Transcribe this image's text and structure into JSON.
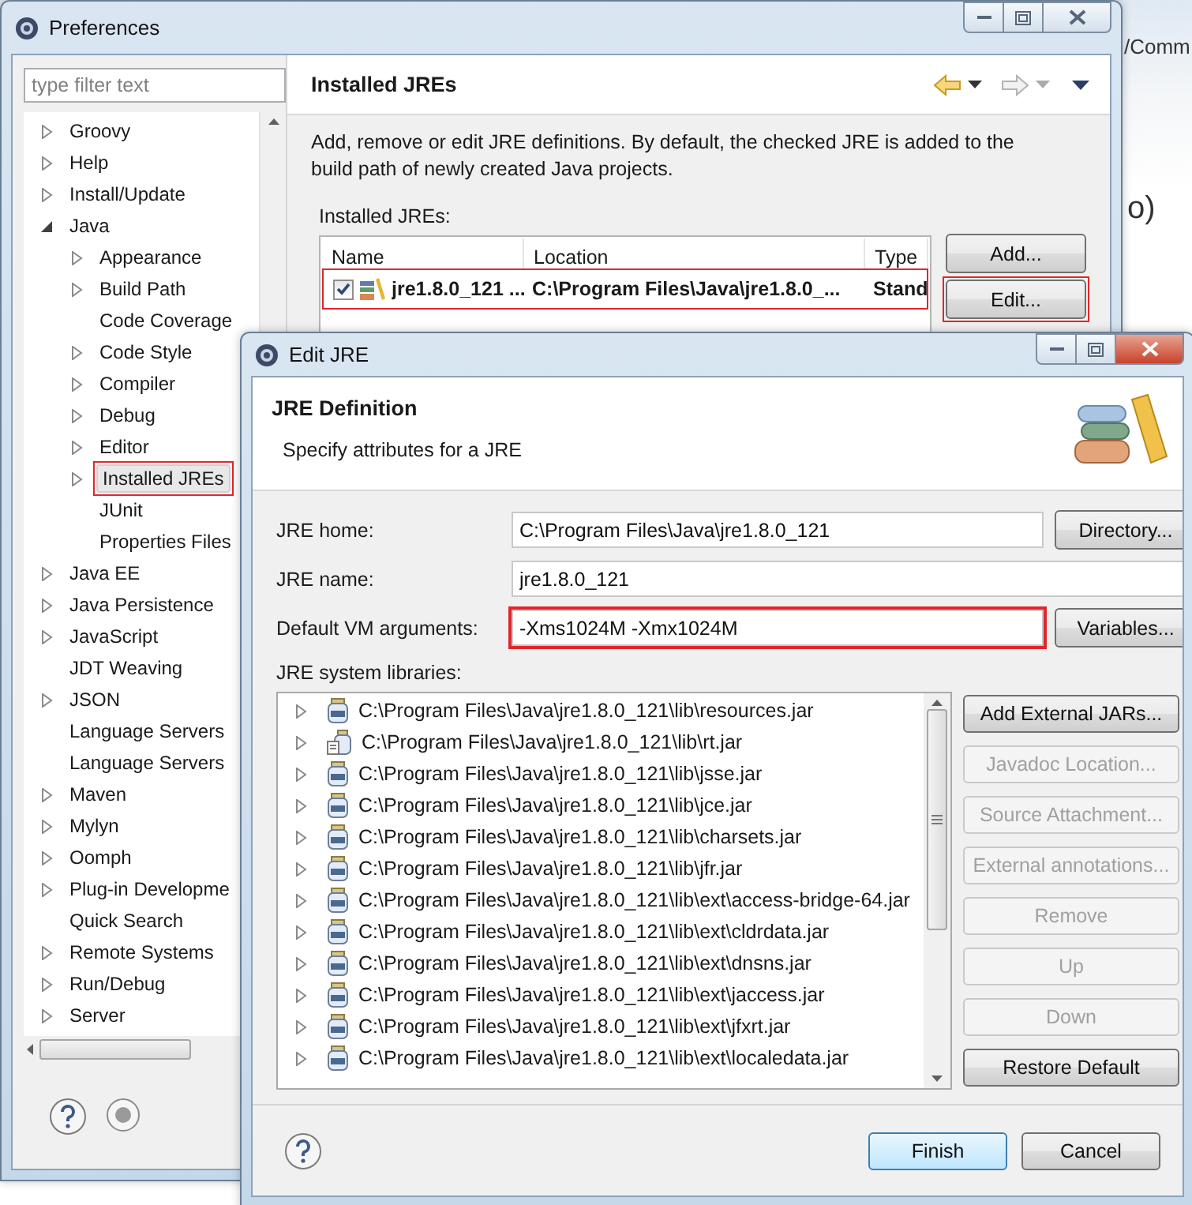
{
  "background": {
    "texts": [
      "/Comm",
      "o)"
    ]
  },
  "preferences": {
    "title": "Preferences",
    "filter": {
      "placeholder": "type filter text"
    },
    "tree": [
      {
        "label": "Groovy",
        "expanded": false,
        "selected": false
      },
      {
        "label": "Help",
        "expanded": false,
        "selected": false
      },
      {
        "label": "Install/Update",
        "expanded": false,
        "selected": false
      },
      {
        "label": "Java",
        "expanded": true,
        "selected": false,
        "children": [
          {
            "label": "Appearance",
            "expanded": false,
            "selected": false
          },
          {
            "label": "Build Path",
            "expanded": false,
            "selected": false
          },
          {
            "label": "Code Coverage",
            "selected": false
          },
          {
            "label": "Code Style",
            "expanded": false,
            "selected": false
          },
          {
            "label": "Compiler",
            "expanded": false,
            "selected": false
          },
          {
            "label": "Debug",
            "expanded": false,
            "selected": false
          },
          {
            "label": "Editor",
            "expanded": false,
            "selected": false
          },
          {
            "label": "Installed JREs",
            "expanded": false,
            "selected": true,
            "annotated": true
          },
          {
            "label": "JUnit",
            "selected": false
          },
          {
            "label": "Properties Files",
            "selected": false
          }
        ]
      },
      {
        "label": "Java EE",
        "expanded": false,
        "selected": false
      },
      {
        "label": "Java Persistence",
        "expanded": false,
        "selected": false
      },
      {
        "label": "JavaScript",
        "expanded": false,
        "selected": false
      },
      {
        "label": "JDT Weaving",
        "selected": false
      },
      {
        "label": "JSON",
        "expanded": false,
        "selected": false
      },
      {
        "label": "Language Servers",
        "selected": false
      },
      {
        "label": "Language Servers",
        "selected": false
      },
      {
        "label": "Maven",
        "expanded": false,
        "selected": false
      },
      {
        "label": "Mylyn",
        "expanded": false,
        "selected": false
      },
      {
        "label": "Oomph",
        "expanded": false,
        "selected": false
      },
      {
        "label": "Plug-in Developme",
        "expanded": false,
        "selected": false
      },
      {
        "label": "Quick Search",
        "selected": false
      },
      {
        "label": "Remote Systems",
        "expanded": false,
        "selected": false
      },
      {
        "label": "Run/Debug",
        "expanded": false,
        "selected": false
      },
      {
        "label": "Server",
        "expanded": false,
        "selected": false
      }
    ],
    "page": {
      "title": "Installed JREs",
      "description": "Add, remove or edit JRE definitions. By default, the checked JRE is added to the build path of newly created Java projects.",
      "table_label": "Installed JREs:",
      "columns": [
        "Name",
        "Location",
        "Type"
      ],
      "rows": [
        {
          "checked": true,
          "annotated": true,
          "cells": [
            "jre1.8.0_121 ...",
            "C:\\Program Files\\Java\\jre1.8.0_...",
            "Stand"
          ]
        }
      ],
      "buttons": [
        {
          "label": "Add...",
          "annotated": false
        },
        {
          "label": "Edit...",
          "annotated": true
        }
      ]
    }
  },
  "dialog": {
    "title": "Edit JRE",
    "header": {
      "title": "JRE Definition",
      "subtitle": "Specify attributes for a JRE"
    },
    "fields": [
      {
        "label": "JRE home:",
        "value": "C:\\Program Files\\Java\\jre1.8.0_121",
        "button": "Directory...",
        "annotated": false
      },
      {
        "label": "JRE name:",
        "value": "jre1.8.0_121",
        "annotated": false
      },
      {
        "label": "Default VM arguments:",
        "value": "-Xms1024M -Xmx1024M",
        "button": "Variables...",
        "annotated": true
      }
    ],
    "libraries_label": "JRE system libraries:",
    "libraries": [
      {
        "path": "C:\\Program Files\\Java\\jre1.8.0_121\\lib\\resources.jar",
        "kind": "jar"
      },
      {
        "path": "C:\\Program Files\\Java\\jre1.8.0_121\\lib\\rt.jar",
        "kind": "source"
      },
      {
        "path": "C:\\Program Files\\Java\\jre1.8.0_121\\lib\\jsse.jar",
        "kind": "jar"
      },
      {
        "path": "C:\\Program Files\\Java\\jre1.8.0_121\\lib\\jce.jar",
        "kind": "jar"
      },
      {
        "path": "C:\\Program Files\\Java\\jre1.8.0_121\\lib\\charsets.jar",
        "kind": "jar"
      },
      {
        "path": "C:\\Program Files\\Java\\jre1.8.0_121\\lib\\jfr.jar",
        "kind": "jar"
      },
      {
        "path": "C:\\Program Files\\Java\\jre1.8.0_121\\lib\\ext\\access-bridge-64.jar",
        "kind": "jar"
      },
      {
        "path": "C:\\Program Files\\Java\\jre1.8.0_121\\lib\\ext\\cldrdata.jar",
        "kind": "jar"
      },
      {
        "path": "C:\\Program Files\\Java\\jre1.8.0_121\\lib\\ext\\dnsns.jar",
        "kind": "jar"
      },
      {
        "path": "C:\\Program Files\\Java\\jre1.8.0_121\\lib\\ext\\jaccess.jar",
        "kind": "jar"
      },
      {
        "path": "C:\\Program Files\\Java\\jre1.8.0_121\\lib\\ext\\jfxrt.jar",
        "kind": "jar"
      },
      {
        "path": "C:\\Program Files\\Java\\jre1.8.0_121\\lib\\ext\\localedata.jar",
        "kind": "jar"
      }
    ],
    "library_buttons": [
      {
        "label": "Add External JARs...",
        "disabled": false
      },
      {
        "label": "Javadoc Location...",
        "disabled": true
      },
      {
        "label": "Source Attachment...",
        "disabled": true
      },
      {
        "label": "External annotations...",
        "disabled": true
      },
      {
        "label": "Remove",
        "disabled": true
      },
      {
        "label": "Up",
        "disabled": true
      },
      {
        "label": "Down",
        "disabled": true
      },
      {
        "label": "Restore Default",
        "disabled": false
      }
    ],
    "buttons": [
      {
        "label": "Finish",
        "default": true
      },
      {
        "label": "Cancel",
        "default": false
      }
    ]
  }
}
